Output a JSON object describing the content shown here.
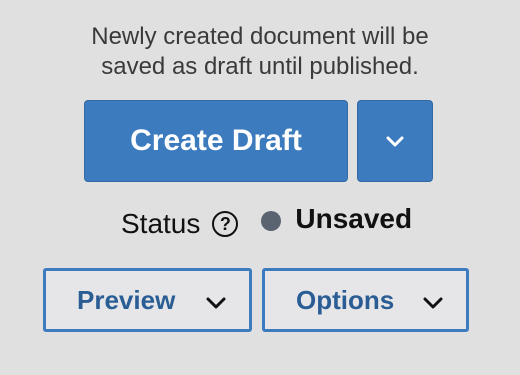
{
  "panel": {
    "help_line1": "Newly created document will be",
    "help_line2": "saved as draft until published."
  },
  "actions": {
    "primary_label": "Create Draft",
    "dropdown_icon": "chevron-down-icon",
    "primary_color": "#3d7bbf"
  },
  "status": {
    "label": "Status",
    "help_icon": "question-icon",
    "help_glyph": "?",
    "value": "Unsaved",
    "dot_color": "#5a6470"
  },
  "secondary": {
    "preview_label": "Preview",
    "options_label": "Options"
  }
}
